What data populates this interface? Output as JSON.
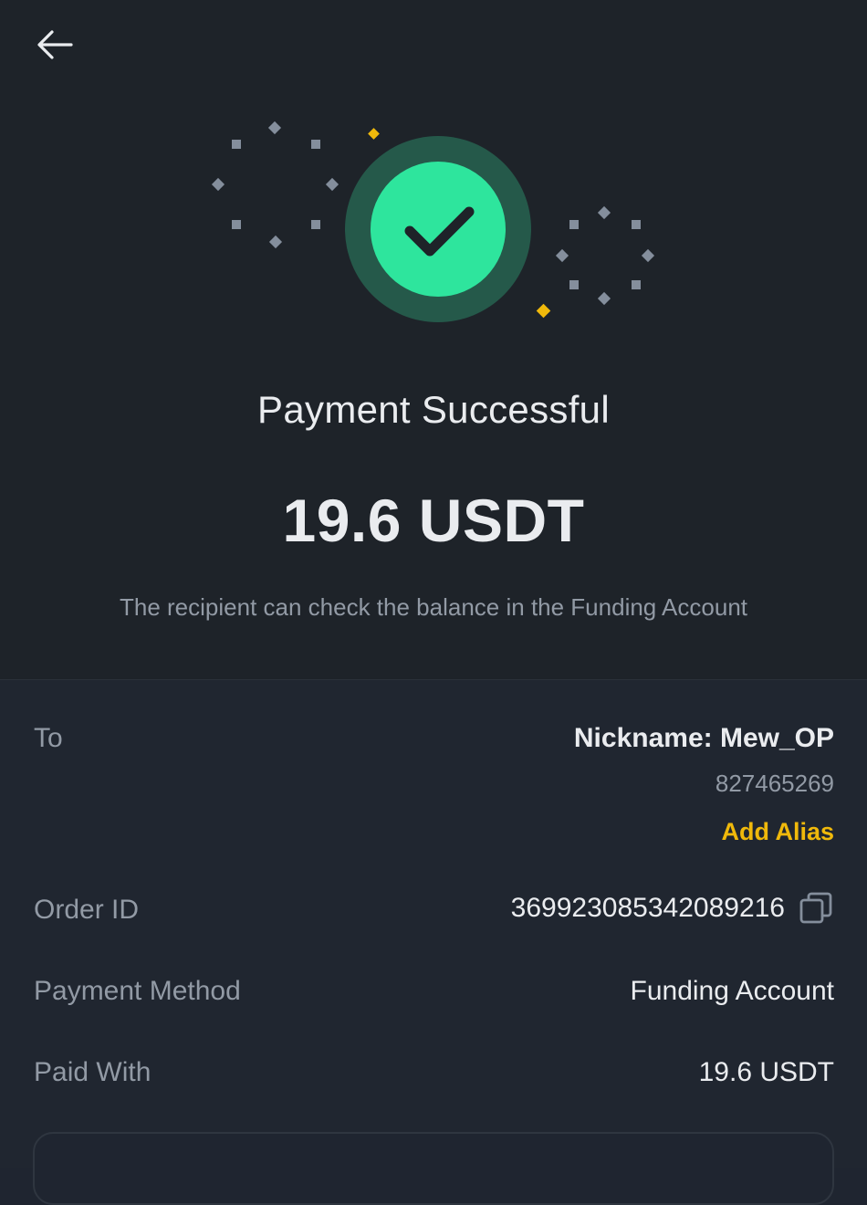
{
  "header": {
    "back_icon": "arrow-left-icon"
  },
  "hero": {
    "icon": "check-circle-icon",
    "accent_color": "#2ee59d",
    "ring_color": "#25594a",
    "spark_color": "#f0b90b"
  },
  "status": {
    "title": "Payment Successful",
    "amount": "19.6 USDT",
    "note": "The recipient can check the balance in the Funding Account"
  },
  "details": {
    "to_label": "To",
    "nickname": "Nickname: Mew_OP",
    "uid": "827465269",
    "add_alias": "Add Alias",
    "order_id_label": "Order ID",
    "order_id": "369923085342089216",
    "copy_icon": "copy-icon",
    "payment_method_label": "Payment Method",
    "payment_method": "Funding Account",
    "paid_with_label": "Paid With",
    "paid_with": "19.6 USDT"
  }
}
